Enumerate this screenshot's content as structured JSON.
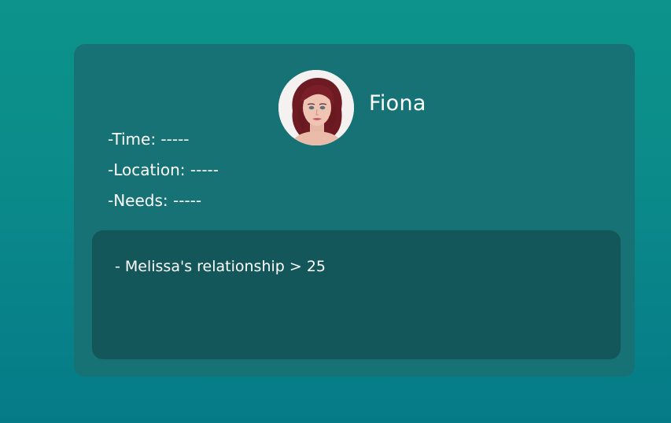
{
  "character": {
    "name": "Fiona",
    "avatar_icon": "character-portrait-icon"
  },
  "info": [
    {
      "label": "-Time: ",
      "value": "-----"
    },
    {
      "label": "-Location: ",
      "value": "-----"
    },
    {
      "label": "-Needs: ",
      "value": "-----"
    }
  ],
  "requirements": [
    "- Melissa's relationship > 25"
  ],
  "colors": {
    "background_top": "#0d938b",
    "background_bottom": "#057b88",
    "card": "#167274",
    "requirements_box": "#13575b",
    "text": "#ffffff"
  }
}
